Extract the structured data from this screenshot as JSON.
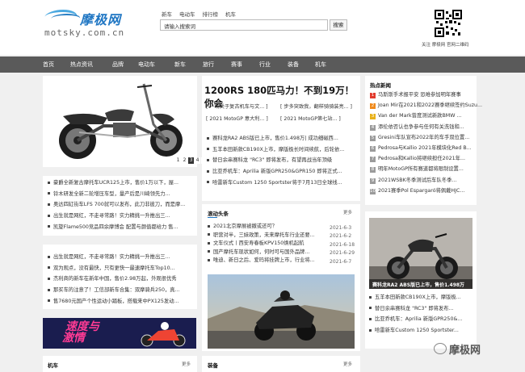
{
  "logo": {
    "name": "摩极网",
    "url": "motsky.com.cn"
  },
  "toplinks": [
    "新车",
    "电动车",
    "排行榜",
    "机车"
  ],
  "search": {
    "value": "请输入搜索词",
    "button": "搜索"
  },
  "qr_caption": "关注 摩极网 官网二维码",
  "nav": [
    "首页",
    "热点资讯",
    "品牌",
    "电动车",
    "新车",
    "旅行",
    "赛事",
    "行业",
    "装备",
    "机车"
  ],
  "slider": {
    "pages": [
      "1",
      "2",
      "3",
      "4",
      "5"
    ],
    "active": "3"
  },
  "left_list_a": [
    "豪爵全新复古摩托车UCR125上市，售价1万以下，屋...",
    "铃木研发全新二轮增压车型，量产后是川崎领先力...",
    "奥达四缸街车LFS 700就可以发布，此刀非彼刀，而是摩...",
    "出生就是网红，不走寻常路！实力精挑一升推出三...",
    "凯旋Flame500竞品四余摩博会 配置与颜值都给力 售..."
  ],
  "left_list_b": [
    "出生就是网红，不走寻常路！实力精挑一升推出三...",
    "双为观点，没有最快，只有更快一最速摩托车Top10...",
    "杰利商的新车在新年中国，售价2.98万起，外观很优秀",
    "那买车的注意了！工信部新车合集：双摩骑兵250，真...",
    "售7680元国产个性运动小踏板，搭载来中PX125发动..."
  ],
  "banner": {
    "text1": "速度与",
    "text2": "激情"
  },
  "headline": "1200RS 180匹马力！不到19万！你会",
  "headline_links": [
    "[ 一场关于复古机车与文... ]",
    "[ 步多突致我，翻样骑骑装亮... ]",
    "[ 2021 MotoGP 意大利... ]",
    "[ 2021 MotoGP第七站... ]"
  ],
  "center_list": [
    "赛科龙RA2 ABS版已上市，售价1.498万| 成功细磁西...",
    "五羊本田新款CB190X上市，摩版极长时间续航，后轮依...",
    "替日余串赛科龙 \"RC3\" 即将发布，有望再战当年顶级",
    "比亚乔机车：Aprilia 新版GPR250&GPR150 即将正式...",
    "哈雷新车Custom 1250 Sportster将于7月13日全球线..."
  ],
  "rolling": {
    "title": "滚动头条",
    "more": "更多",
    "items": [
      {
        "t": "2021北京摩展被撤或还可？",
        "d": "2021-6-3"
      },
      {
        "t": "职营对半，三妹政策，未来摩托车行业还要...",
        "d": "2021-6-2"
      },
      {
        "t": "文车仪式丨西安寿春板KPV150焕机起航",
        "d": "2021-6-18"
      },
      {
        "t": "国产摩托车现状如何，何时可与国外品牌...",
        "d": "2021-6-29"
      },
      {
        "t": "唯迪、新日之后、爱玛将挂牌上市，行业将...",
        "d": "2021-6-7"
      }
    ]
  },
  "hot": {
    "title": "热点新闻",
    "items": [
      "马斯斯手术报平安 恐难参加明年赛事",
      "Joan Mir在2021和2022赛季继续签约Suzu...",
      "Van der Mark曾度测试新款BMW ...",
      "添伦依否认也争参与任何有关洗钱和...",
      "Gresini车队宣布2022年的车手双位置...",
      "Pedrosa与Kallio 2021年模块化Red B...",
      "Pedrosa和Kallio将继续担任2021年...",
      "明年MotoGP所有赛道都将限制设置...",
      "2021WSBK冬季测试后车队冬季...",
      "2021赛季Pol Espargaró将佩戴HJC..."
    ],
    "colors": [
      "#e23b2e",
      "#f08a1c",
      "#e8b11a",
      "#9b9b9b",
      "#9b9b9b",
      "#9b9b9b",
      "#9b9b9b",
      "#9b9b9b",
      "#9b9b9b",
      "#9b9b9b"
    ]
  },
  "right_photo_caption": "赛科龙RA2 ABS版已上市，售价1.498万",
  "right_list": [
    "五羊本田新款CB190X上市，摩版极...",
    "替日余串赛科龙 \"RC3\" 即将发布...",
    "比亚乔机车：Aprilia 新版GPR250&...",
    "哈雷新车Custom 1250 Sportster..."
  ],
  "bottom": {
    "left": "机车",
    "left_more": "更多",
    "center": "装备",
    "center_more": "更多"
  },
  "watermark": "摩极网"
}
